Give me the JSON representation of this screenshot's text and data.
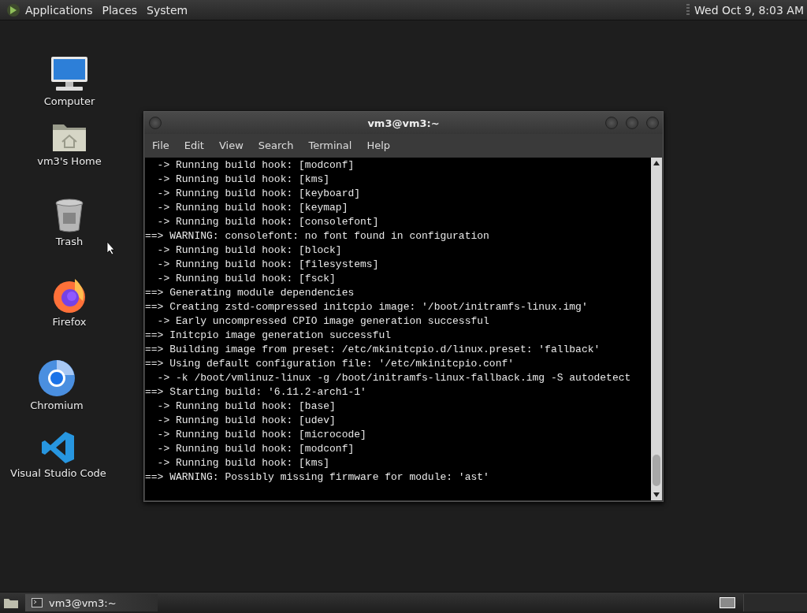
{
  "top_panel": {
    "menus": [
      "Applications",
      "Places",
      "System"
    ],
    "clock": "Wed Oct 9, 8:03 AM"
  },
  "desktop_icons": [
    {
      "kind": "computer",
      "label": "Computer"
    },
    {
      "kind": "home",
      "label": "vm3's Home"
    },
    {
      "kind": "trash",
      "label": "Trash"
    },
    {
      "kind": "firefox",
      "label": "Firefox"
    },
    {
      "kind": "chromium",
      "label": "Chromium"
    },
    {
      "kind": "vscode",
      "label": "Visual Studio Code"
    }
  ],
  "window": {
    "title": "vm3@vm3:~",
    "menu": [
      "File",
      "Edit",
      "View",
      "Search",
      "Terminal",
      "Help"
    ],
    "lines": [
      "  -> Running build hook: [modconf]",
      "  -> Running build hook: [kms]",
      "  -> Running build hook: [keyboard]",
      "  -> Running build hook: [keymap]",
      "  -> Running build hook: [consolefont]",
      "==> WARNING: consolefont: no font found in configuration",
      "  -> Running build hook: [block]",
      "  -> Running build hook: [filesystems]",
      "  -> Running build hook: [fsck]",
      "==> Generating module dependencies",
      "==> Creating zstd-compressed initcpio image: '/boot/initramfs-linux.img'",
      "  -> Early uncompressed CPIO image generation successful",
      "==> Initcpio image generation successful",
      "==> Building image from preset: /etc/mkinitcpio.d/linux.preset: 'fallback'",
      "==> Using default configuration file: '/etc/mkinitcpio.conf'",
      "  -> -k /boot/vmlinuz-linux -g /boot/initramfs-linux-fallback.img -S autodetect",
      "==> Starting build: '6.11.2-arch1-1'",
      "  -> Running build hook: [base]",
      "  -> Running build hook: [udev]",
      "  -> Running build hook: [microcode]",
      "  -> Running build hook: [modconf]",
      "  -> Running build hook: [kms]",
      "==> WARNING: Possibly missing firmware for module: 'ast'"
    ]
  },
  "taskbar": {
    "tasks": [
      {
        "label": "vm3@vm3:~",
        "selected": true
      }
    ]
  }
}
